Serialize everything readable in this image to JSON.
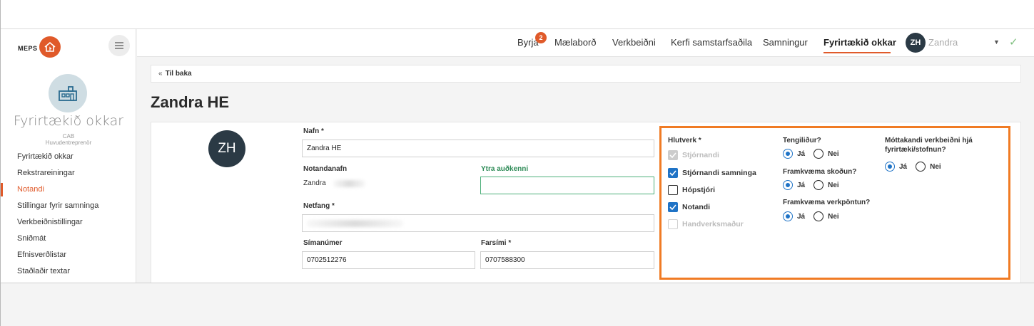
{
  "sidebar": {
    "logo_text": "MEPS",
    "org_title": "Fyrirtækið okkar",
    "org_code": "CAB",
    "org_role": "Huvudentreprenör",
    "items": [
      {
        "label": "Fyrirtækið okkar",
        "active": false
      },
      {
        "label": "Rekstrareiningar",
        "active": false
      },
      {
        "label": "Notandi",
        "active": true
      },
      {
        "label": "Stillingar fyrir samninga",
        "active": false
      },
      {
        "label": "Verkbeiðnistillingar",
        "active": false
      },
      {
        "label": "Sniðmát",
        "active": false
      },
      {
        "label": "Efnisverðlistar",
        "active": false
      },
      {
        "label": "Staðlaðir textar",
        "active": false
      }
    ]
  },
  "topnav": {
    "items": [
      {
        "label": "Byrja"
      },
      {
        "label": "Mælaborð"
      },
      {
        "label": "Verkbeiðni"
      },
      {
        "label": "Kerfi samstarfsaðila"
      },
      {
        "label": "Samningur"
      },
      {
        "label": "Fyrirtækið okkar"
      }
    ],
    "active_index": 5,
    "badge_count": "2",
    "user_initials": "ZH",
    "user_name": "Zandra"
  },
  "main": {
    "back_label": "Til baka",
    "page_title": "Zandra HE",
    "avatar_initials": "ZH",
    "form": {
      "name_label": "Nafn *",
      "name_value": "Zandra HE",
      "username_label": "Notandanafn",
      "username_value": "Zandra",
      "external_id_label": "Ytra auðkenni",
      "external_id_value": "",
      "email_label": "Netfang *",
      "email_value": "",
      "phone_label": "Símanúmer",
      "phone_value": "0702512276",
      "mobile_label": "Farsími *",
      "mobile_value": "0707588300"
    },
    "roles": {
      "label": "Hlutverk *",
      "items": [
        {
          "label": "Stjórnandi",
          "checked": true,
          "disabled": true
        },
        {
          "label": "Stjórnandi samninga",
          "checked": true,
          "disabled": false
        },
        {
          "label": "Hópstjóri",
          "checked": false,
          "disabled": false
        },
        {
          "label": "Notandi",
          "checked": true,
          "disabled": false
        },
        {
          "label": "Handverksmaður",
          "checked": false,
          "disabled": true
        }
      ]
    },
    "questions": {
      "contact": {
        "label": "Tengiliður?",
        "value": "Já"
      },
      "inspection": {
        "label": "Framkvæma skoðun?",
        "value": "Já"
      },
      "order": {
        "label": "Framkvæma verkpöntun?",
        "value": "Já"
      },
      "recipient": {
        "label_line1": "Móttakandi verkbeiðni hjá",
        "label_line2": "fyrirtæki/stofnun?",
        "value": "Já"
      },
      "yes_label": "Já",
      "no_label": "Nei"
    },
    "highlight_color": "#f07b24",
    "accent_color": "#e05a2a",
    "check_color": "#1f73c6"
  }
}
